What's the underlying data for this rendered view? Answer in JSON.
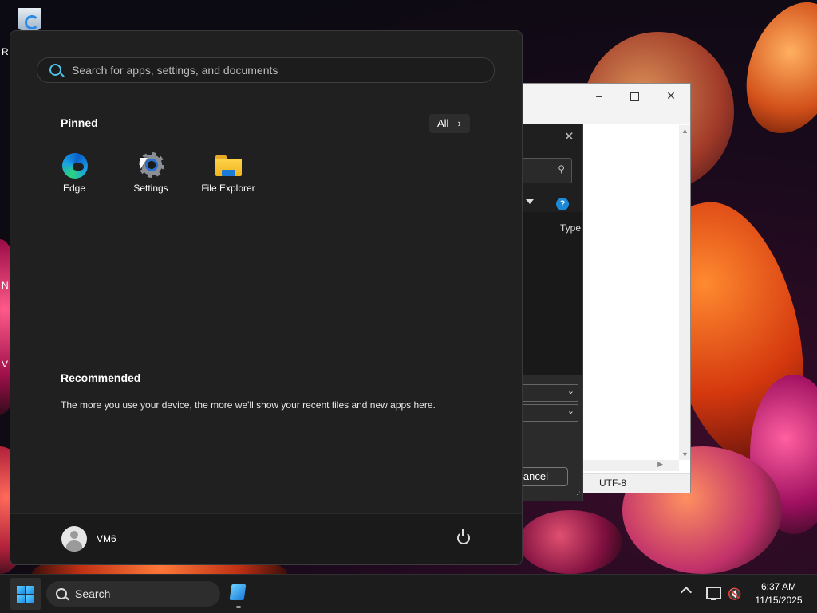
{
  "desktop": {
    "icons": [
      {
        "label": "R"
      },
      {
        "label": "N"
      },
      {
        "label": "V"
      }
    ]
  },
  "notepad": {
    "status_encoding": "UTF-8"
  },
  "dialog": {
    "column_type": "Type",
    "cancel_label": "Cancel"
  },
  "start_menu": {
    "search_placeholder": "Search for apps, settings, and documents",
    "pinned_title": "Pinned",
    "all_label": "All",
    "pinned_apps": [
      {
        "label": "Edge",
        "icon": "edge-icon"
      },
      {
        "label": "Settings",
        "icon": "gear-icon"
      },
      {
        "label": "File Explorer",
        "icon": "folder-icon"
      }
    ],
    "recommended_title": "Recommended",
    "recommended_text": "The more you use your device, the more we'll show your recent files and new apps here.",
    "user_name": "VM6"
  },
  "taskbar": {
    "search_label": "Search",
    "time": "6:37 AM",
    "date": "11/15/2025"
  },
  "colors": {
    "accent": "#4ec1e8",
    "start_bg": "#202020",
    "taskbar_bg": "#1c1c1c"
  }
}
